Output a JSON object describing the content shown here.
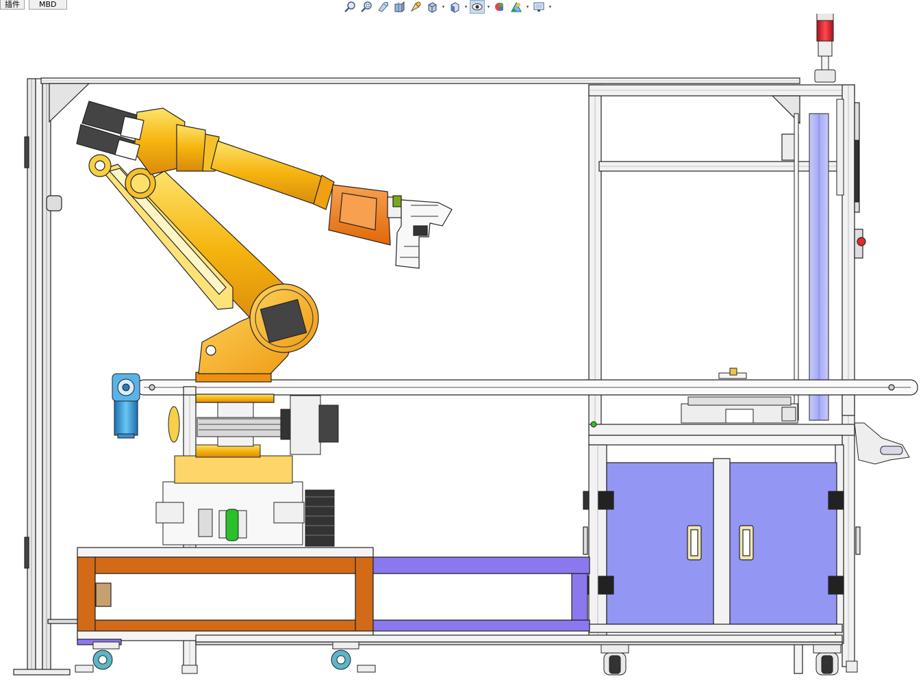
{
  "tabs": [
    {
      "label": "插件"
    },
    {
      "label": "MBD"
    }
  ],
  "toolbar": {
    "buttons": [
      {
        "icon": "zoom-to-fit-icon"
      },
      {
        "icon": "zoom-to-area-icon"
      },
      {
        "icon": "previous-view-icon"
      },
      {
        "icon": "section-view-icon"
      },
      {
        "icon": "dynamic-annotation-icon"
      },
      {
        "icon": "view-orientation-icon",
        "dropdown": true
      },
      {
        "icon": "display-style-icon",
        "dropdown": true
      },
      {
        "icon": "hide-show-items-icon",
        "dropdown": true,
        "active": true
      },
      {
        "icon": "edit-appearance-icon"
      },
      {
        "icon": "apply-scene-icon",
        "dropdown": true
      },
      {
        "icon": "view-settings-icon",
        "dropdown": true
      }
    ]
  },
  "viewport": {
    "model": "robot-arm-workcell-assembly",
    "colors": {
      "robot": "#f6b40e",
      "robot_dark": "#e08a0a",
      "tool": "#f07818",
      "cabinet_door": "#9496f4",
      "frame_base": "#d26a18",
      "rail": "#8c78ee",
      "beacon": "#e8202c",
      "motor": "#3fa3e0",
      "guide": "#b4b8f6"
    }
  }
}
